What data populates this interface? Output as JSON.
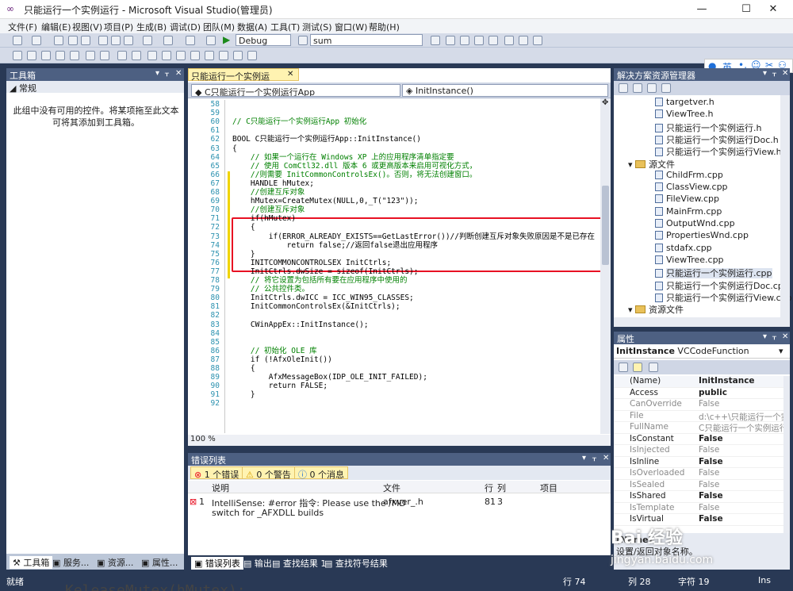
{
  "window": {
    "title": "只能运行一个实例运行 - Microsoft Visual Studio(管理员)",
    "min": "—",
    "max": "☐",
    "close": "✕"
  },
  "menu": [
    "文件(F)",
    "编辑(E)",
    "视图(V)",
    "项目(P)",
    "生成(B)",
    "调试(D)",
    "团队(M)",
    "数据(A)",
    "工具(T)",
    "测试(S)",
    "窗口(W)",
    "帮助(H)"
  ],
  "toolbar": {
    "config": "Debug",
    "find": "sum"
  },
  "ime": {
    "label": "英"
  },
  "toolbox": {
    "title": "工具箱",
    "group": "常规",
    "empty_msg": "此组中没有可用的控件。将某项拖至此文本可将其添加到工具箱。",
    "tabs": [
      "工具箱",
      "服务...",
      "资源...",
      "属性..."
    ]
  },
  "editor": {
    "tab": "只能运行一个实例运行.cpp*",
    "class_combo": "C只能运行一个实例运行App",
    "method_combo": "InitInstance()",
    "zoom": "100 %",
    "lines": [
      {
        "n": "58",
        "t": ""
      },
      {
        "n": "59",
        "t": ""
      },
      {
        "n": "60",
        "t": "// C只能运行一个实例运行App 初始化",
        "c": "cm"
      },
      {
        "n": "61",
        "t": ""
      },
      {
        "n": "62",
        "t": "BOOL C只能运行一个实例运行App::InitInstance()"
      },
      {
        "n": "63",
        "t": "{"
      },
      {
        "n": "64",
        "t": "    // 如果一个运行在 Windows XP 上的应用程序清单指定要",
        "c": "cm"
      },
      {
        "n": "65",
        "t": "    // 使用 ComCtl32.dll 版本 6 或更高版本来启用可视化方式，",
        "c": "cm"
      },
      {
        "n": "66",
        "t": "    //则需要 InitCommonControlsEx()。否则，将无法创建窗口。",
        "c": "cm"
      },
      {
        "n": "67",
        "t": "    HANDLE hMutex;"
      },
      {
        "n": "68",
        "t": "    //创建互斥对象",
        "c": "cm"
      },
      {
        "n": "69",
        "t": "    hMutex=CreateMutex(NULL,0,_T(\"123\"));"
      },
      {
        "n": "70",
        "t": "    //创建互斥对象",
        "c": "cm"
      },
      {
        "n": "71",
        "t": "    if(hMutex)"
      },
      {
        "n": "72",
        "t": "    {"
      },
      {
        "n": "73",
        "t": "        if(ERROR_ALREADY_EXISTS==GetLastError())//判断创建互斥对象失败原因是不是已存在"
      },
      {
        "n": "74",
        "t": "            return false;//返回false退出应用程序"
      },
      {
        "n": "75",
        "t": "    }"
      },
      {
        "n": "76",
        "t": "    INITCOMMONCONTROLSEX InitCtrls;"
      },
      {
        "n": "77",
        "t": "    InitCtrls.dwSize = sizeof(InitCtrls);"
      },
      {
        "n": "78",
        "t": "    // 将它设置为包括所有要在应用程序中使用的",
        "c": "cm"
      },
      {
        "n": "79",
        "t": "    // 公共控件类。",
        "c": "cm"
      },
      {
        "n": "80",
        "t": "    InitCtrls.dwICC = ICC_WIN95_CLASSES;"
      },
      {
        "n": "81",
        "t": "    InitCommonControlsEx(&InitCtrls);"
      },
      {
        "n": "82",
        "t": ""
      },
      {
        "n": "83",
        "t": "    CWinAppEx::InitInstance();"
      },
      {
        "n": "84",
        "t": ""
      },
      {
        "n": "85",
        "t": ""
      },
      {
        "n": "86",
        "t": "    // 初始化 OLE 库",
        "c": "cm"
      },
      {
        "n": "87",
        "t": "    if (!AfxOleInit())"
      },
      {
        "n": "88",
        "t": "    {"
      },
      {
        "n": "89",
        "t": "        AfxMessageBox(IDP_OLE_INIT_FAILED);"
      },
      {
        "n": "90",
        "t": "        return FALSE;"
      },
      {
        "n": "91",
        "t": "    }"
      },
      {
        "n": "92",
        "t": ""
      }
    ]
  },
  "errors": {
    "title": "错误列表",
    "filters": [
      "1 个错误",
      "0 个警告",
      "0 个消息"
    ],
    "headers": [
      "说明",
      "文件",
      "行",
      "列",
      "项目"
    ],
    "rows": [
      {
        "num": "1",
        "desc1": "IntelliSense: #error 指令: Please use the /MD",
        "desc2": "switch for _AFXDLL builds",
        "file": "afxver_.h",
        "line": "81",
        "col": "3",
        "project": ""
      }
    ]
  },
  "bottom_tabs": [
    "错误列表",
    "输出",
    "查找结果 1",
    "查找符号结果"
  ],
  "solution": {
    "title": "解决方案资源管理器",
    "items": [
      {
        "label": "targetver.h",
        "type": "file",
        "indent": 2
      },
      {
        "label": "ViewTree.h",
        "type": "file",
        "indent": 2
      },
      {
        "label": "只能运行一个实例运行.h",
        "type": "file",
        "indent": 2
      },
      {
        "label": "只能运行一个实例运行Doc.h",
        "type": "file",
        "indent": 2
      },
      {
        "label": "只能运行一个实例运行View.h",
        "type": "file",
        "indent": 2
      },
      {
        "label": "源文件",
        "type": "folder",
        "indent": 1
      },
      {
        "label": "ChildFrm.cpp",
        "type": "file",
        "indent": 2
      },
      {
        "label": "ClassView.cpp",
        "type": "file",
        "indent": 2
      },
      {
        "label": "FileView.cpp",
        "type": "file",
        "indent": 2
      },
      {
        "label": "MainFrm.cpp",
        "type": "file",
        "indent": 2
      },
      {
        "label": "OutputWnd.cpp",
        "type": "file",
        "indent": 2
      },
      {
        "label": "PropertiesWnd.cpp",
        "type": "file",
        "indent": 2
      },
      {
        "label": "stdafx.cpp",
        "type": "file",
        "indent": 2
      },
      {
        "label": "ViewTree.cpp",
        "type": "file",
        "indent": 2
      },
      {
        "label": "只能运行一个实例运行.cpp",
        "type": "file",
        "indent": 2
      },
      {
        "label": "只能运行一个实例运行Doc.cpp",
        "type": "file",
        "indent": 2
      },
      {
        "label": "只能运行一个实例运行View.cpp",
        "type": "file",
        "indent": 2
      },
      {
        "label": "资源文件",
        "type": "folder",
        "indent": 1
      }
    ]
  },
  "properties": {
    "title": "属性",
    "object": "InitInstance",
    "object_type": "VCCodeFunction",
    "rows": [
      {
        "k": "(Name)",
        "v": "InitInstance",
        "bold": true
      },
      {
        "k": "Access",
        "v": "public",
        "bold": true
      },
      {
        "k": "CanOverride",
        "v": "False",
        "gray": true
      },
      {
        "k": "File",
        "v": "d:\\c++\\只能运行一个实",
        "gray": true
      },
      {
        "k": "FullName",
        "v": "C只能运行一个实例运行",
        "gray": true
      },
      {
        "k": "IsConstant",
        "v": "False",
        "bold": true
      },
      {
        "k": "IsInjected",
        "v": "False",
        "gray": true
      },
      {
        "k": "IsInline",
        "v": "False",
        "bold": true
      },
      {
        "k": "IsOverloaded",
        "v": "False",
        "gray": true
      },
      {
        "k": "IsSealed",
        "v": "False",
        "gray": true
      },
      {
        "k": "IsShared",
        "v": "False",
        "bold": true
      },
      {
        "k": "IsTemplate",
        "v": "False",
        "gray": true
      },
      {
        "k": "IsVirtual",
        "v": "False",
        "bold": true
      }
    ],
    "desc_title": "(Name)",
    "desc_text": "设置/返回对象名称。"
  },
  "status": {
    "ready": "就绪",
    "line": "行 74",
    "col": "列 28",
    "ch": "字符 19",
    "ins": "Ins"
  },
  "overlay_code": "KeleaseMutex(hMutex);",
  "watermark": {
    "brand": "Bai 经验",
    "url": "jingyan.baidu.com"
  }
}
